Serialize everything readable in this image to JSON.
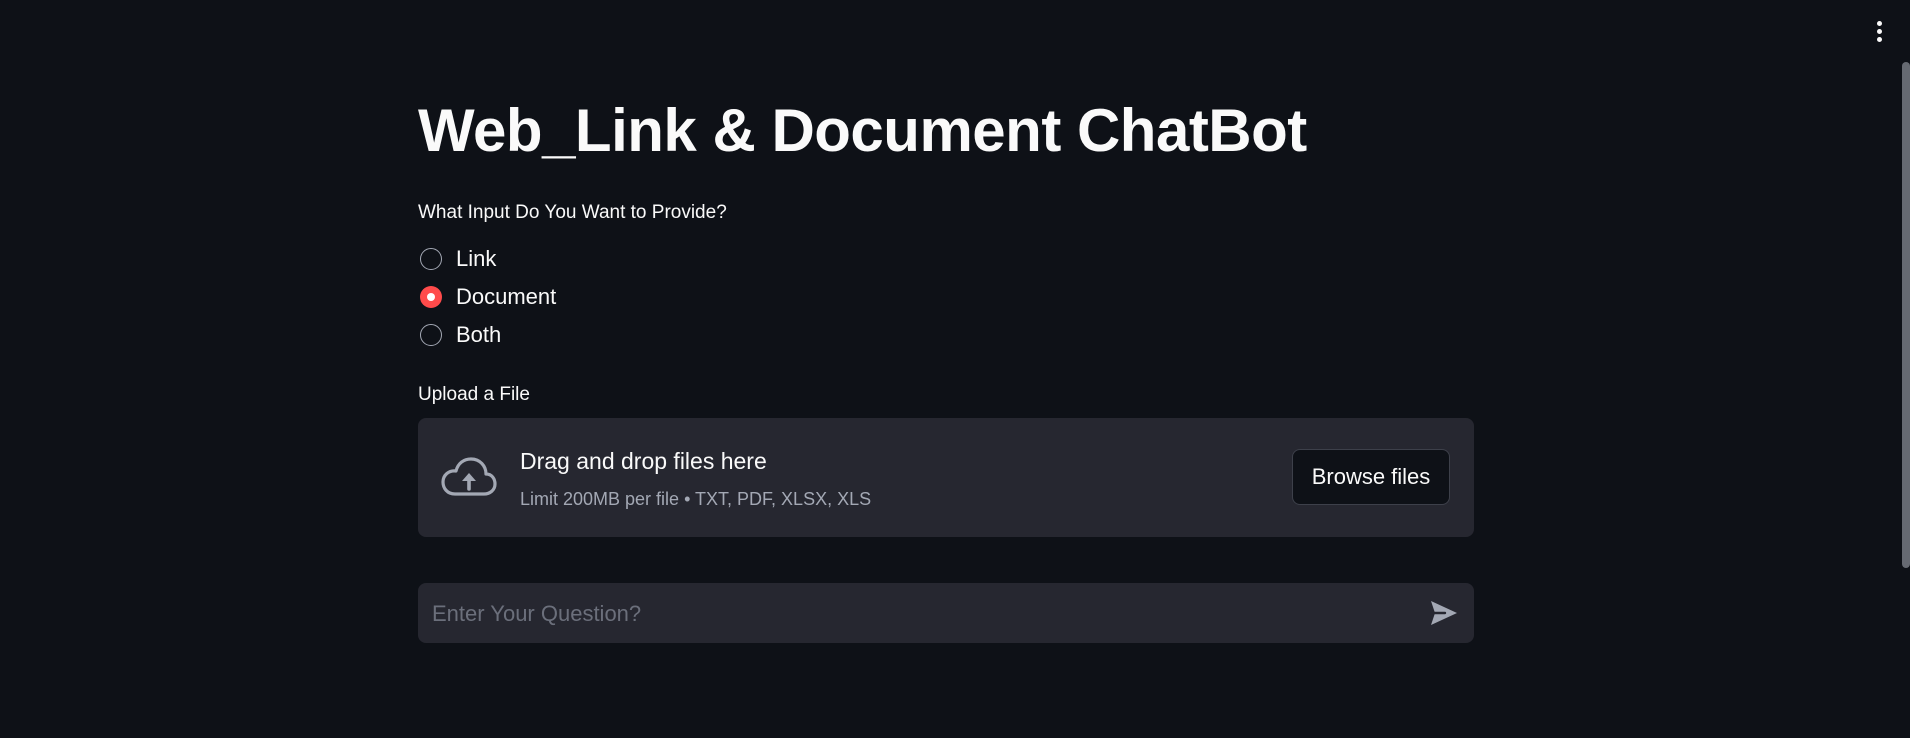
{
  "app": {
    "title": "Web_Link & Document ChatBot"
  },
  "header": {
    "menu_icon": "kebab-menu-icon"
  },
  "input_type": {
    "label": "What Input Do You Want to Provide?",
    "options": [
      {
        "label": "Link",
        "selected": false
      },
      {
        "label": "Document",
        "selected": true
      },
      {
        "label": "Both",
        "selected": false
      }
    ]
  },
  "uploader": {
    "label": "Upload a File",
    "drop_title": "Drag and drop files here",
    "drop_subtitle": "Limit 200MB per file • TXT, PDF, XLSX, XLS",
    "browse_label": "Browse files",
    "icon": "cloud-upload-icon"
  },
  "chat": {
    "placeholder": "Enter Your Question?",
    "value": "",
    "send_icon": "send-icon"
  },
  "colors": {
    "background": "#0e1117",
    "surface": "#262730",
    "accent": "#ff4b4b",
    "text": "#fafafa",
    "muted": "#a3a8b4"
  }
}
